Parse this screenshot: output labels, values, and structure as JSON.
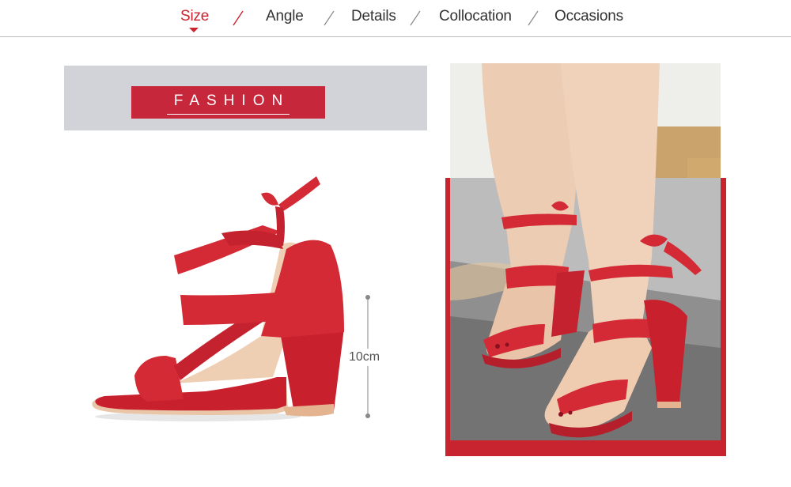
{
  "nav": {
    "tabs": [
      {
        "label": "Size",
        "active": true
      },
      {
        "label": "Angle",
        "active": false
      },
      {
        "label": "Details",
        "active": false
      },
      {
        "label": "Collocation",
        "active": false
      },
      {
        "label": "Occasions",
        "active": false
      }
    ]
  },
  "banner": {
    "badge_text": "FASHION"
  },
  "product": {
    "heel_height": "10cm"
  },
  "colors": {
    "accent": "#c8242f",
    "banner_bg": "#d2d3d8",
    "sandal_red": "#d42a35"
  }
}
